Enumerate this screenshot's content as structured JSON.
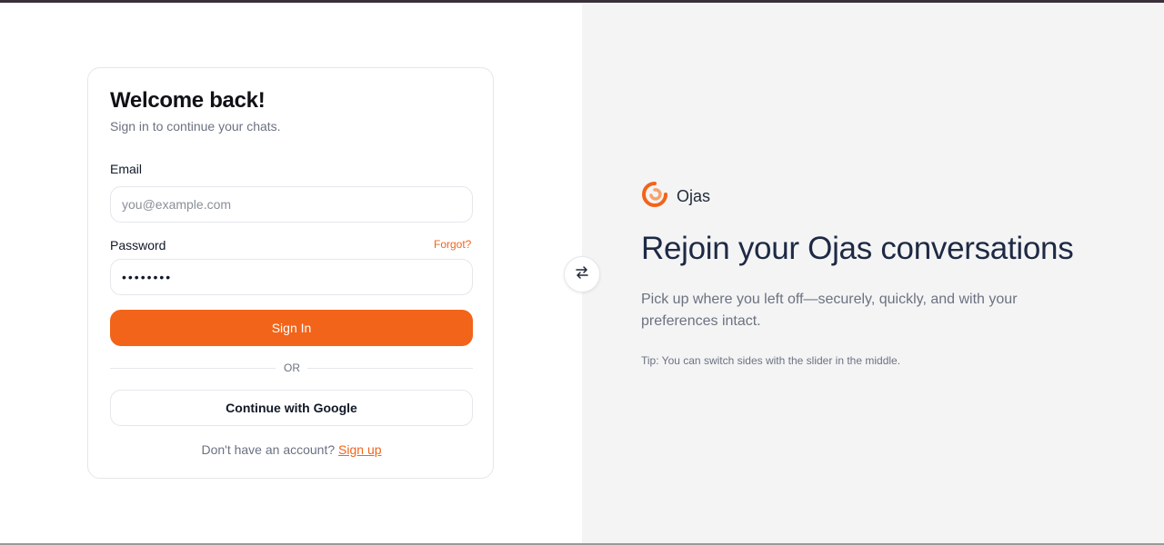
{
  "login": {
    "title": "Welcome back!",
    "subtitle": "Sign in to continue your chats.",
    "email_label": "Email",
    "email_placeholder": "you@example.com",
    "email_value": "",
    "password_label": "Password",
    "password_value": "••••••••",
    "forgot_label": "Forgot?",
    "signin_label": "Sign In",
    "divider_label": "OR",
    "google_label": "Continue with Google",
    "signup_prompt": "Don't have an account?",
    "signup_label": "Sign up"
  },
  "swap": {
    "icon": "swap-arrows-icon"
  },
  "brand": {
    "name": "Ojas",
    "logo_icon": "ojas-logo-icon",
    "accent_color": "#f26419"
  },
  "hero": {
    "title": "Rejoin your Ojas conversations",
    "description": "Pick up where you left off—securely, quickly, and with your preferences intact.",
    "tip": "Tip: You can switch sides with the slider in the middle."
  }
}
